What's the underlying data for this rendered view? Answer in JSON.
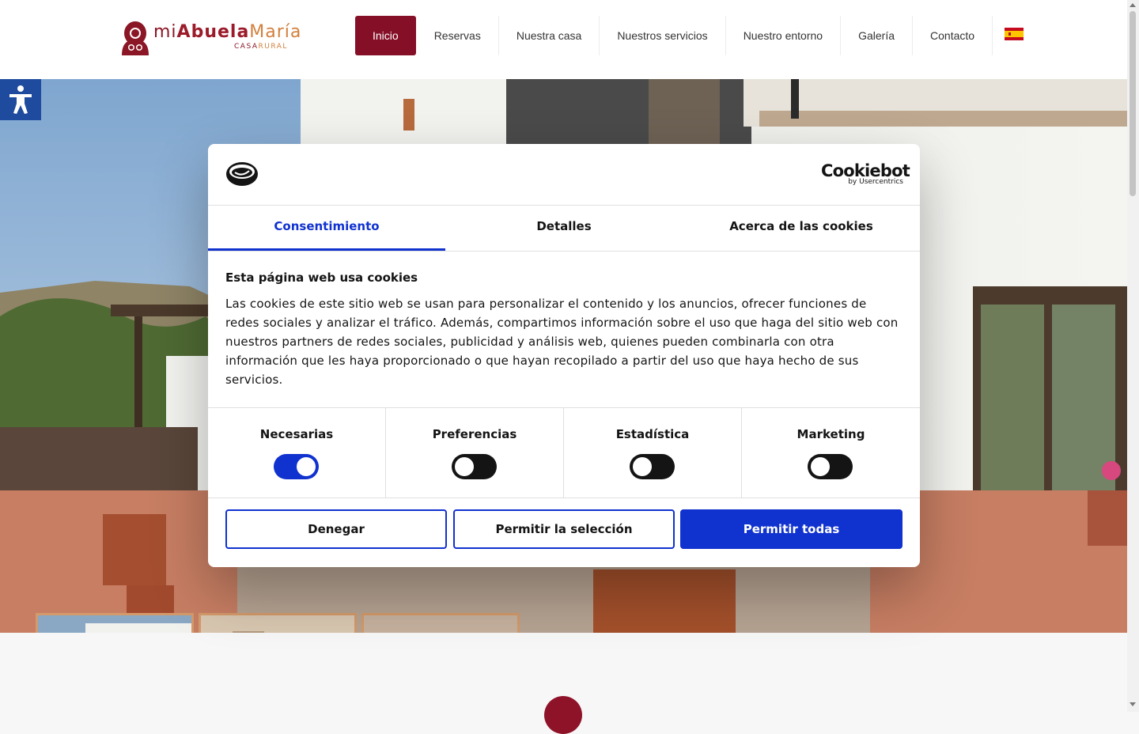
{
  "header": {
    "logo": {
      "part1": "mi",
      "part2": "Abuela",
      "part3": "María",
      "sub1": "CASA",
      "sub2": "RURAL"
    },
    "nav": [
      {
        "label": "Inicio",
        "active": true
      },
      {
        "label": "Reservas"
      },
      {
        "label": "Nuestra casa"
      },
      {
        "label": "Nuestros servicios"
      },
      {
        "label": "Nuestro entorno"
      },
      {
        "label": "Galería"
      },
      {
        "label": "Contacto"
      }
    ],
    "language_flag_icon": "spain-flag-icon"
  },
  "colors": {
    "brand": "#860f28",
    "cookiebot_accent": "#1032cf",
    "thumb_border": "#d49a6a",
    "accessibility_button": "#1e4b9e"
  },
  "cookie_dialog": {
    "brand": {
      "title": "Cookiebot",
      "subtitle": "by Usercentrics"
    },
    "tabs": [
      "Consentimiento",
      "Detalles",
      "Acerca de las cookies"
    ],
    "heading": "Esta página web usa cookies",
    "body": "Las cookies de este sitio web se usan para personalizar el contenido y los anuncios, ofrecer funciones de redes sociales y analizar el tráfico. Además, compartimos información sobre el uso que haga del sitio web con nuestros partners de redes sociales, publicidad y análisis web, quienes pueden combinarla con otra información que les haya proporcionado o que hayan recopilado a partir del uso que haya hecho de sus servicios.",
    "categories": [
      {
        "label": "Necesarias",
        "on": true
      },
      {
        "label": "Preferencias",
        "on": false
      },
      {
        "label": "Estadística",
        "on": false
      },
      {
        "label": "Marketing",
        "on": false
      }
    ],
    "buttons": {
      "deny": "Denegar",
      "allow_selection": "Permitir la selección",
      "allow_all": "Permitir todas"
    }
  }
}
